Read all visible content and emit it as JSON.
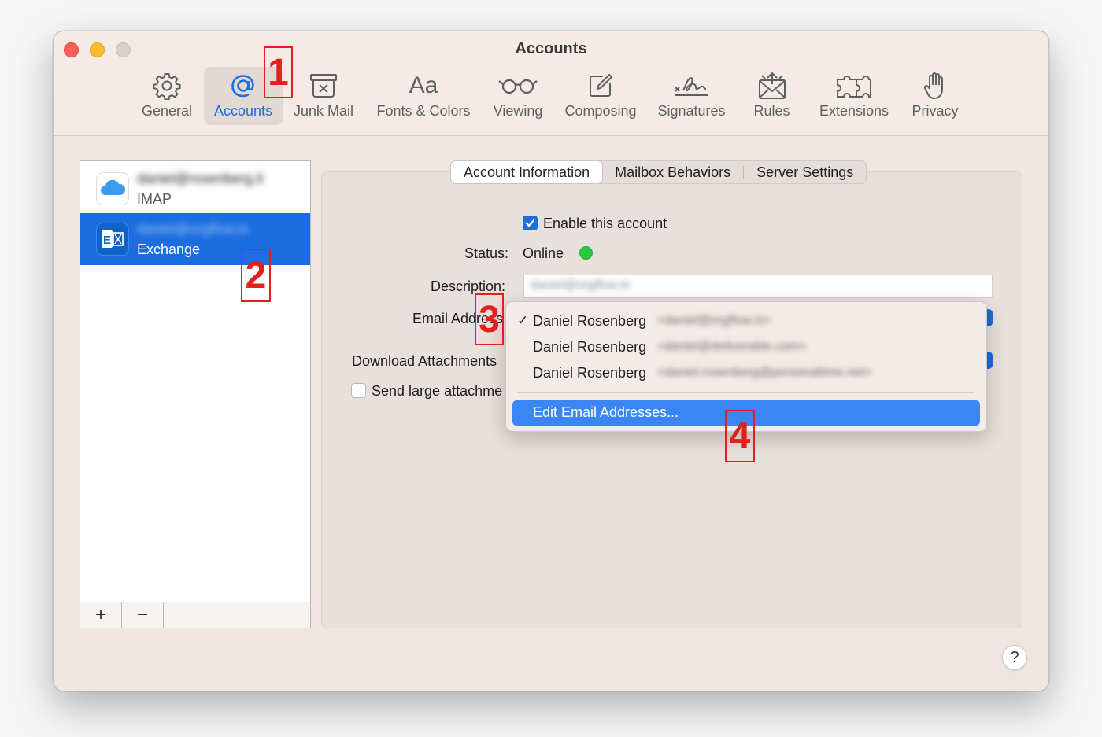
{
  "window": {
    "title": "Accounts"
  },
  "toolbar": {
    "items": [
      {
        "label": "General",
        "icon": "gear-icon"
      },
      {
        "label": "Accounts",
        "icon": "at-icon"
      },
      {
        "label": "Junk Mail",
        "icon": "junk-icon"
      },
      {
        "label": "Fonts & Colors",
        "icon": "fonts-icon"
      },
      {
        "label": "Viewing",
        "icon": "glasses-icon"
      },
      {
        "label": "Composing",
        "icon": "compose-icon"
      },
      {
        "label": "Signatures",
        "icon": "signature-icon"
      },
      {
        "label": "Rules",
        "icon": "rules-icon"
      },
      {
        "label": "Extensions",
        "icon": "puzzle-icon"
      },
      {
        "label": "Privacy",
        "icon": "hand-icon"
      }
    ],
    "selected": "Accounts",
    "accent_color": "#1b6fe0"
  },
  "sidebar": {
    "accounts": [
      {
        "name": "daniel@rosenberg.li",
        "type": "IMAP",
        "icon": "icloud-icon"
      },
      {
        "name": "daniel@orgflow.io",
        "type": "Exchange",
        "icon": "exchange-icon"
      }
    ],
    "selected_color": "#1b6de0",
    "add_label": "+",
    "remove_label": "−"
  },
  "tabs": [
    {
      "label": "Account Information"
    },
    {
      "label": "Mailbox Behaviors"
    },
    {
      "label": "Server Settings"
    }
  ],
  "account_info": {
    "enable_label": "Enable this account",
    "status_label": "Status:",
    "status_value": "Online",
    "status_color": "#28c840",
    "description_label": "Description:",
    "description_value": "daniel@orgflow.io",
    "email_label": "Email Address",
    "download_label": "Download Attachments",
    "send_large_label": "Send large attachme"
  },
  "email_menu": {
    "items": [
      {
        "name": "Daniel Rosenberg",
        "email": "<daniel@orgflow.io>",
        "checked": "✓"
      },
      {
        "name": "Daniel Rosenberg",
        "email": "<daniel@deliverable.com>",
        "checked": ""
      },
      {
        "name": "Daniel Rosenberg",
        "email": "<daniel.rosenberg@personaltime.net>",
        "checked": ""
      }
    ],
    "edit_label": "Edit Email Addresses...",
    "highlight_color": "#3b86f2"
  },
  "annotations": [
    "1",
    "2",
    "3",
    "4"
  ],
  "help_label": "?"
}
